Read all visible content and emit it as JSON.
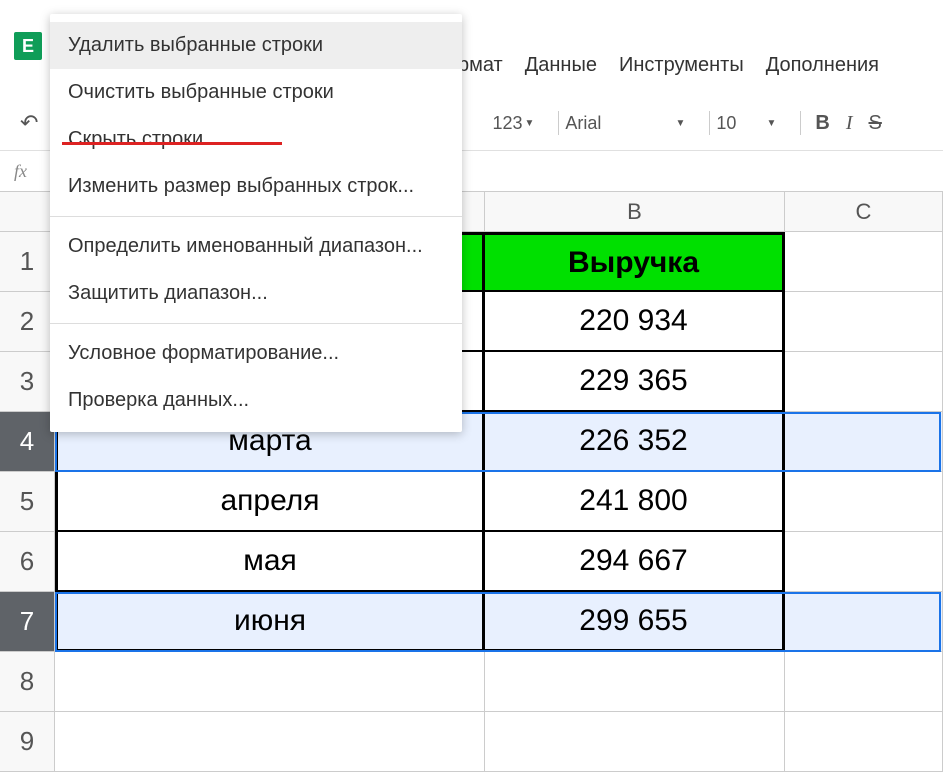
{
  "menubar": {
    "format": "рмат",
    "data": "Данные",
    "tools": "Инструменты",
    "addons": "Дополнения"
  },
  "toolbar": {
    "num123": "123",
    "font": "Arial",
    "size": "10",
    "bold": "B",
    "italic": "I",
    "strike": "S"
  },
  "fx": "fx",
  "columns": {
    "A": "",
    "B": "B",
    "C": "C"
  },
  "rows": [
    {
      "num": "1",
      "a": "",
      "b": "Выручка",
      "header": true
    },
    {
      "num": "2",
      "a": "",
      "b": "220 934"
    },
    {
      "num": "3",
      "a": "",
      "b": "229 365"
    },
    {
      "num": "4",
      "a": "марта",
      "b": "226 352",
      "selected": true
    },
    {
      "num": "5",
      "a": "апреля",
      "b": "241 800"
    },
    {
      "num": "6",
      "a": "мая",
      "b": "294 667"
    },
    {
      "num": "7",
      "a": "июня",
      "b": "299 655",
      "selected": true
    },
    {
      "num": "8",
      "a": "",
      "b": ""
    },
    {
      "num": "9",
      "a": "",
      "b": ""
    }
  ],
  "context_menu": {
    "delete_rows": "Удалить выбранные строки",
    "clear_rows": "Очистить выбранные строки",
    "hide_rows": "Скрыть строки",
    "resize_rows": "Изменить размер выбранных строк...",
    "named_range": "Определить именованный диапазон...",
    "protect_range": "Защитить диапазон...",
    "cond_format": "Условное форматирование...",
    "data_valid": "Проверка данных..."
  }
}
